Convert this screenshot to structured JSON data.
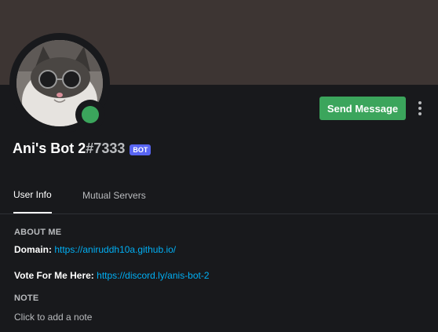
{
  "profile": {
    "username": "Ani's Bot 2",
    "discriminator": "#7333",
    "badge": "BOT",
    "status_color": "#3ba55c",
    "banner_color": "#3d3533"
  },
  "actions": {
    "send_message": "Send Message",
    "more_icon": "more-vertical-icon"
  },
  "tabs": [
    {
      "label": "User Info",
      "active": true
    },
    {
      "label": "Mutual Servers",
      "active": false
    }
  ],
  "about": {
    "heading": "ABOUT ME",
    "domain_label": "Domain:",
    "domain_link": "https://aniruddh10a.github.io/",
    "vote_label": "Vote For Me Here:",
    "vote_link": "https://discord.ly/anis-bot-2"
  },
  "note": {
    "heading": "NOTE",
    "placeholder": "Click to add a note"
  },
  "colors": {
    "accent_green": "#3ba55c",
    "bot_badge": "#5865f2",
    "link": "#00aff4",
    "background": "#18191c"
  }
}
